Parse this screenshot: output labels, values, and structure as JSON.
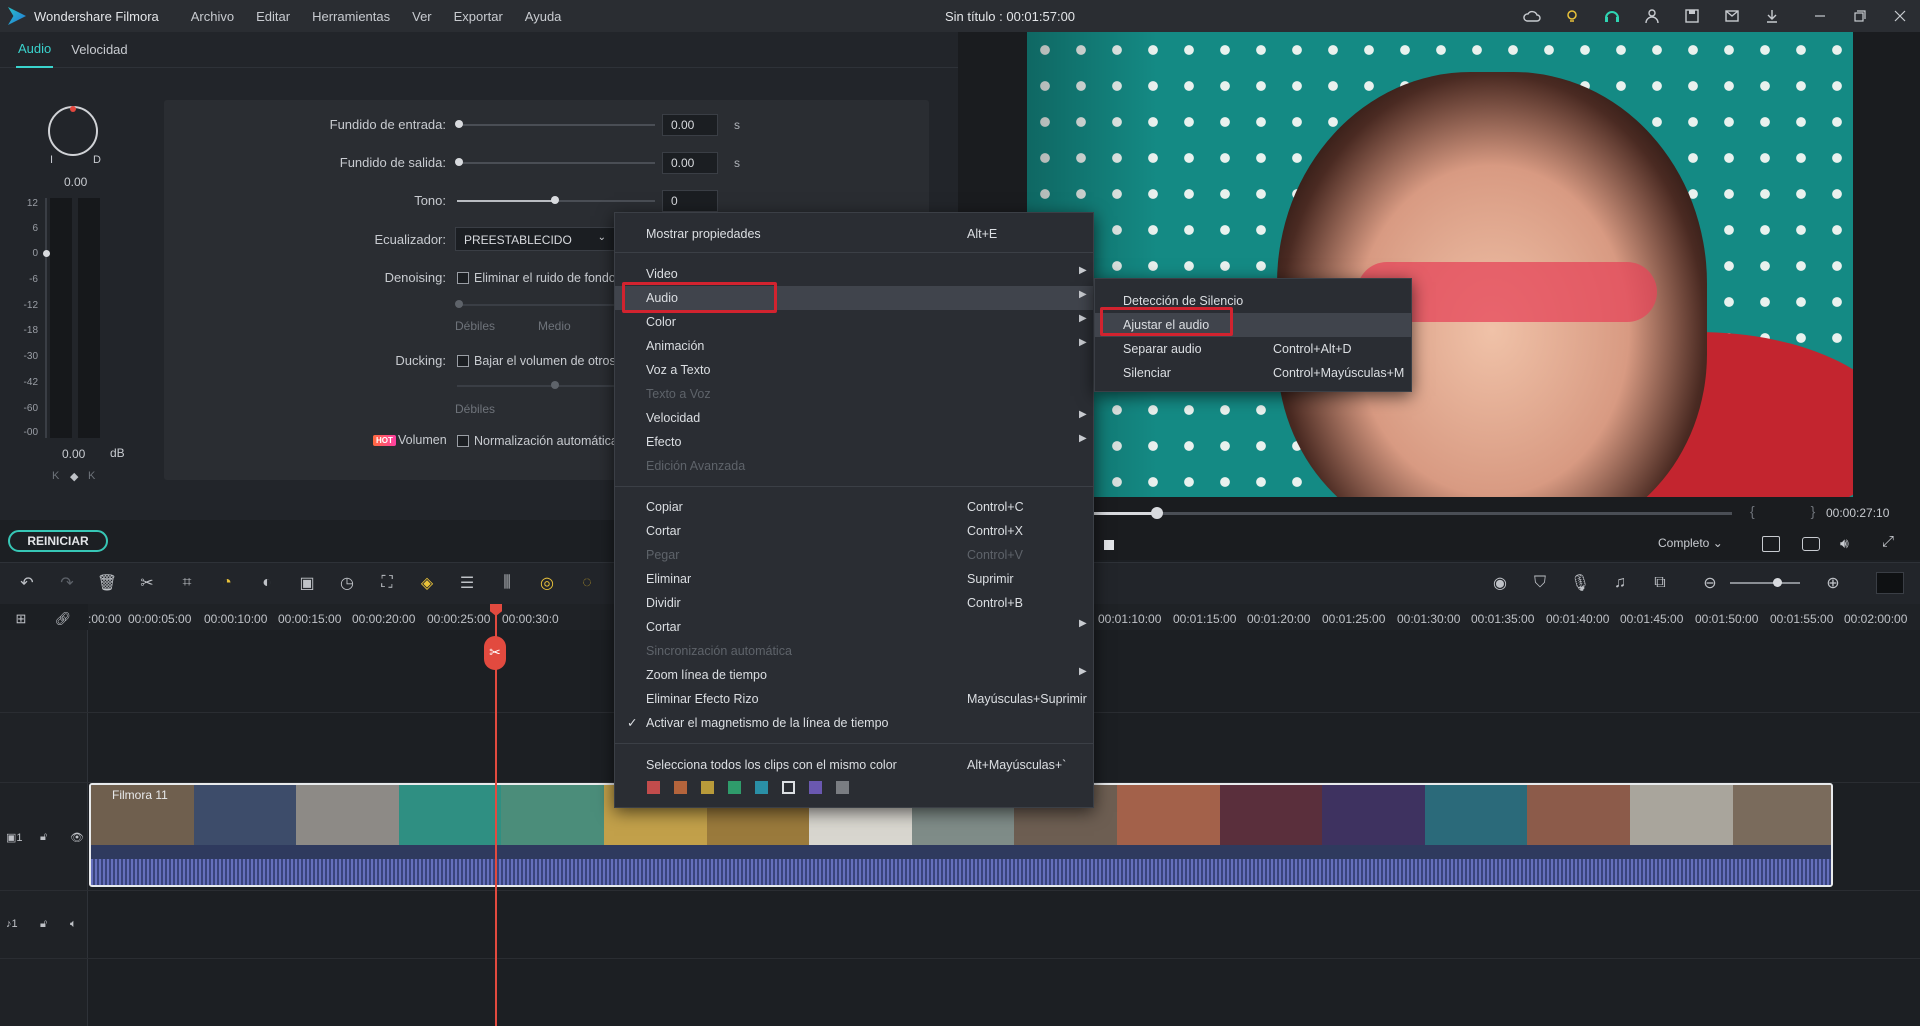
{
  "app": {
    "name": "Wondershare Filmora",
    "title": "Sin título : 00:01:57:00"
  },
  "menubar": [
    "Archivo",
    "Editar",
    "Herramientas",
    "Ver",
    "Exportar",
    "Ayuda"
  ],
  "tabs": [
    "Audio",
    "Velocidad"
  ],
  "audio_panel": {
    "knob_left": "I",
    "knob_right": "D",
    "knob_value": "0.00",
    "db_scale": [
      "12",
      "6",
      "0",
      "-6",
      "-12",
      "-18",
      "-30",
      "-42",
      "-60",
      "-00"
    ],
    "meter_value": "0.00",
    "meter_unit": "dB",
    "fade_in_label": "Fundido de entrada:",
    "fade_in_value": "0.00",
    "fade_in_unit": "s",
    "fade_out_label": "Fundido  de salida:",
    "fade_out_value": "0.00",
    "fade_out_unit": "s",
    "pitch_label": "Tono:",
    "pitch_value": "0",
    "eq_label": "Ecualizador:",
    "eq_value": "PREESTABLECIDO",
    "denoise_label": "Denoising:",
    "denoise_check": "Eliminar el ruido de fondo",
    "denoise_low": "Débiles",
    "denoise_mid": "Medio",
    "ducking_label": "Ducking:",
    "ducking_check": "Bajar el volumen de otros",
    "ducking_low": "Débiles",
    "hot_badge": "HOT",
    "volume_label": "Volumen",
    "normalize_check": "Normalización automática"
  },
  "reset_label": "REINICIAR",
  "preview": {
    "timecode": "00:00:27:10",
    "brackets": "{ }",
    "quality": "Completo",
    "progress": 0.1
  },
  "ruler_ticks": [
    ":00:00",
    "00:00:05:00",
    "00:00:10:00",
    "00:00:15:00",
    "00:00:20:00",
    "00:00:25:00",
    "00:00:30:0",
    "00:01:10:00",
    "00:01:15:00",
    "00:01:20:00",
    "00:01:25:00",
    "00:01:30:00",
    "00:01:35:00",
    "00:01:40:00",
    "00:01:45:00",
    "00:01:50:00",
    "00:01:55:00",
    "00:02:00:00"
  ],
  "clip": {
    "title": "Filmora 11"
  },
  "tracks": {
    "video": "1",
    "audio": "1"
  },
  "context_menu": {
    "items": [
      {
        "label": "Mostrar propiedades",
        "shortcut": "Alt+E",
        "arrow": false,
        "disabled": false
      },
      {
        "label": "Video",
        "shortcut": "",
        "arrow": true,
        "disabled": false
      },
      {
        "label": "Audio",
        "shortcut": "",
        "arrow": true,
        "disabled": false,
        "highlighted": true
      },
      {
        "label": "Color",
        "shortcut": "",
        "arrow": true,
        "disabled": false
      },
      {
        "label": "Animación",
        "shortcut": "",
        "arrow": true,
        "disabled": false
      },
      {
        "label": "Voz a Texto",
        "shortcut": "",
        "arrow": false,
        "disabled": false
      },
      {
        "label": "Texto a Voz",
        "shortcut": "",
        "arrow": false,
        "disabled": true
      },
      {
        "label": "Velocidad",
        "shortcut": "",
        "arrow": true,
        "disabled": false
      },
      {
        "label": "Efecto",
        "shortcut": "",
        "arrow": true,
        "disabled": false
      },
      {
        "label": "Edición Avanzada",
        "shortcut": "",
        "arrow": false,
        "disabled": true
      },
      {
        "label": "Copiar",
        "shortcut": "Control+C",
        "arrow": false,
        "disabled": false
      },
      {
        "label": "Cortar",
        "shortcut": "Control+X",
        "arrow": false,
        "disabled": false
      },
      {
        "label": "Pegar",
        "shortcut": "Control+V",
        "arrow": false,
        "disabled": true
      },
      {
        "label": "Eliminar",
        "shortcut": "Suprimir",
        "arrow": false,
        "disabled": false
      },
      {
        "label": "Dividir",
        "shortcut": "Control+B",
        "arrow": false,
        "disabled": false
      },
      {
        "label": "Cortar",
        "shortcut": "",
        "arrow": true,
        "disabled": false
      },
      {
        "label": "Sincronización automática",
        "shortcut": "",
        "arrow": false,
        "disabled": true
      },
      {
        "label": "Zoom línea de tiempo",
        "shortcut": "",
        "arrow": true,
        "disabled": false
      },
      {
        "label": "Eliminar Efecto Rizo",
        "shortcut": "Mayúsculas+Suprimir",
        "arrow": false,
        "disabled": false
      },
      {
        "label": "Activar el magnetismo de la línea de tiempo",
        "shortcut": "",
        "arrow": false,
        "disabled": false,
        "checked": true
      },
      {
        "label": "Selecciona todos los clips con el mismo color",
        "shortcut": "Alt+Mayúsculas+`",
        "arrow": false,
        "disabled": false
      }
    ],
    "color_swatches": [
      "#c24c4c",
      "#b4643c",
      "#b89a3a",
      "#2f9b6b",
      "#2a8fa6",
      "#dcdfe3",
      "#6a58b0",
      "#7a7d82"
    ]
  },
  "submenu": {
    "items": [
      {
        "label": "Detección de Silencio",
        "shortcut": ""
      },
      {
        "label": "Ajustar el audio",
        "shortcut": "",
        "highlighted": true
      },
      {
        "label": "Separar audio",
        "shortcut": "Control+Alt+D"
      },
      {
        "label": "Silenciar",
        "shortcut": "Control+Mayúsculas+M"
      }
    ]
  },
  "colors": {
    "accent": "#3ad3cd",
    "playhead": "#e24a3f",
    "highlight_box": "#d2232f"
  }
}
